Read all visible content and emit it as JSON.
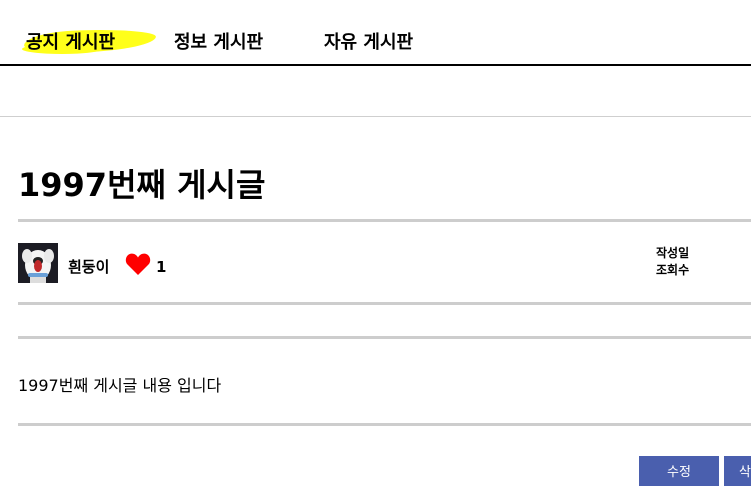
{
  "nav": {
    "tabs": [
      {
        "label": "공지 게시판",
        "active": true
      },
      {
        "label": "정보 게시판",
        "active": false
      },
      {
        "label": "자유 게시판",
        "active": false
      }
    ],
    "highlight_color": "#ffff1a"
  },
  "post": {
    "title": "1997번째 게시글",
    "author": "흰둥이",
    "likes": "1",
    "date_label": "작성일",
    "views_label": "조회수",
    "content": "1997번째 게시글 내용 입니다"
  },
  "actions": {
    "edit_label": "수정",
    "delete_label": "삭제"
  },
  "colors": {
    "button": "#4a5fae",
    "heart": "#ff0000",
    "divider": "#cdcdcd"
  }
}
